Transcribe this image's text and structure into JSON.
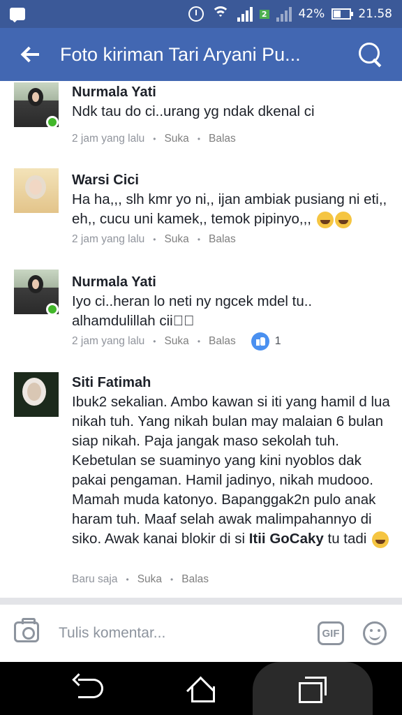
{
  "status_bar": {
    "battery_percent": "42%",
    "time": "21.58",
    "sim2_label": "2"
  },
  "app_bar": {
    "title": "Foto kiriman Tari Aryani Pu..."
  },
  "comments": [
    {
      "author": "Nurmala Yati",
      "text": "Ndk tau do ci..urang yg ndak dkenal ci",
      "time": "2 jam yang lalu",
      "like_label": "Suka",
      "reply_label": "Balas"
    },
    {
      "author": "Warsi Cici",
      "text": "Ha ha,,, slh kmr yo ni,, ijan ambiak pusiang ni eti,, eh,, cucu uni kamek,, temok pipinyo,,,",
      "time": "2 jam yang lalu",
      "like_label": "Suka",
      "reply_label": "Balas"
    },
    {
      "author": "Nurmala Yati",
      "text": "Iyo ci..heran lo neti ny ngcek mdel tu.. alhamdulillah cii\u0000\u0000",
      "time": "2 jam yang lalu",
      "like_label": "Suka",
      "reply_label": "Balas",
      "reaction_count": "1"
    },
    {
      "author": "Siti Fatimah",
      "text": "Ibuk2 sekalian. Ambo kawan si iti yang hamil d lua nikah tuh. Yang nikah bulan may malaian 6 bulan siap nikah. Paja jangak maso sekolah tuh. Kebetulan se suaminyo yang kini nyoblos dak pakai pengaman. Hamil jadinyo, nikah mudooo. Mamah muda katonyo. Bapanggak2n pulo anak haram tuh. Maaf selah awak malimpahannyo di siko. Awak kanai blokir di si",
      "mention": "Itii GoCaky",
      "text_after_mention": " tu tadi",
      "time": "Baru saja",
      "like_label": "Suka",
      "reply_label": "Balas"
    }
  ],
  "composer": {
    "placeholder": "Tulis komentar...",
    "gif_label": "GIF"
  }
}
